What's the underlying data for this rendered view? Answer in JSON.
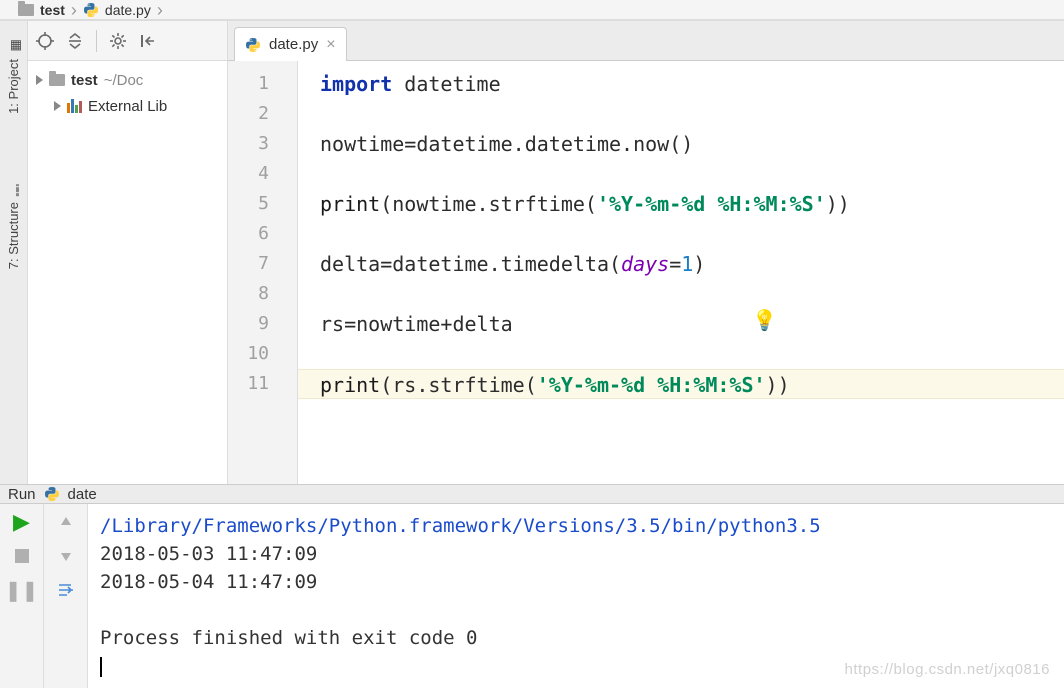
{
  "breadcrumb": {
    "folder": "test",
    "file": "date.py"
  },
  "left_stripe": {
    "project": "1: Project",
    "structure": "7: Structure"
  },
  "project_tree": {
    "root_name": "test",
    "root_path": "~/Doc",
    "external": "External Lib"
  },
  "editor": {
    "tab_label": "date.py",
    "gutter": [
      "1",
      "2",
      "3",
      "4",
      "5",
      "6",
      "7",
      "8",
      "9",
      "10",
      "11"
    ],
    "code": {
      "l1_kw": "import",
      "l1_rest": " datetime",
      "l3": "nowtime=datetime.datetime.now()",
      "l5_pre": "print",
      "l5_mid": "(nowtime.strftime(",
      "l5_str": "'%Y-%m-%d %H:%M:%S'",
      "l5_end": "))",
      "l7_pre": "delta=datetime.timedelta(",
      "l7_arg": "days",
      "l7_eq": "=",
      "l7_num": "1",
      "l7_end": ")",
      "l9": "rs=nowtime+delta",
      "l11_pre": "print",
      "l11_mid": "(rs.strftime(",
      "l11_str": "'%Y-%m-%d %H:%M:%S'",
      "l11_end": "))"
    }
  },
  "run": {
    "title": "Run",
    "config": "date",
    "console": {
      "cmd": "/Library/Frameworks/Python.framework/Versions/3.5/bin/python3.5",
      "out1": "2018-05-03 11:47:09",
      "out2": "2018-05-04 11:47:09",
      "exit": "Process finished with exit code 0"
    }
  },
  "watermark": "https://blog.csdn.net/jxq0816"
}
